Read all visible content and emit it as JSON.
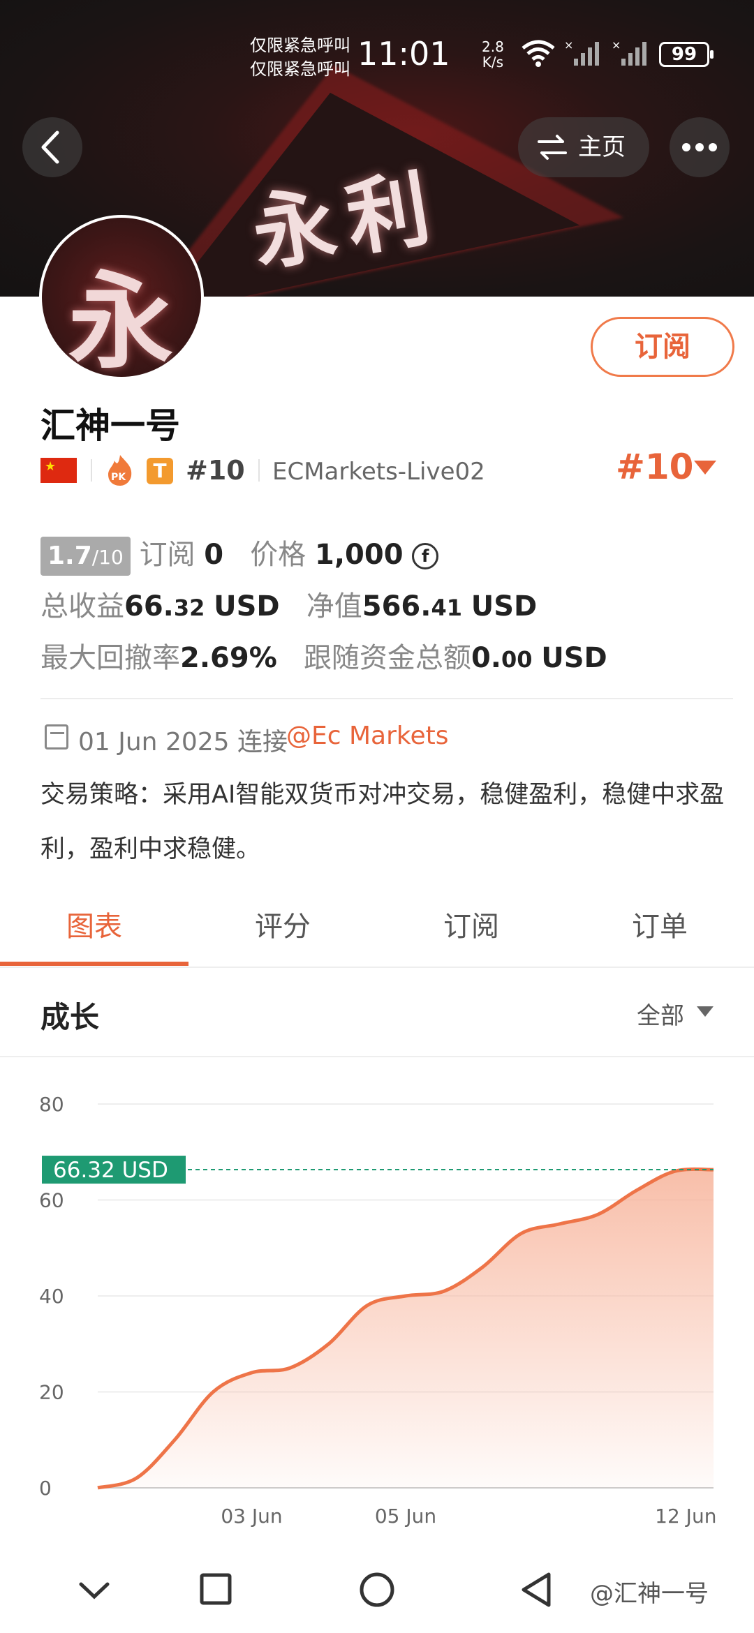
{
  "status_bar": {
    "carrier_line1": "仅限紧急呼叫",
    "carrier_line2": "仅限紧急呼叫",
    "time": "11:01",
    "speed_value": "2.8",
    "speed_unit": "K/s",
    "battery": "99"
  },
  "header": {
    "banner_text": "永利",
    "home_label": "主页"
  },
  "profile": {
    "avatar_char": "永",
    "subscribe_label": "订阅",
    "name": "汇神一号",
    "flag_icon": "china-flag-icon",
    "pk_badge": "PK",
    "t_badge": "T",
    "rank_small": "#10",
    "server": "ECMarkets-Live02",
    "rank_big": "#10"
  },
  "stats": {
    "rating_value": "1.7",
    "rating_denominator": "/10",
    "subscribe_label": "订阅",
    "subscribe_count": "0",
    "price_label": "价格",
    "price_value": "1,000",
    "total_profit_label": "总收益",
    "total_profit_int": "66.",
    "total_profit_dec": "32",
    "total_profit_unit": "USD",
    "net_value_label": "净值",
    "net_value_int": "566.",
    "net_value_dec": "41",
    "net_value_unit": "USD",
    "max_drawdown_label": "最大回撤率",
    "max_drawdown_value": "2.69%",
    "follow_funds_label": "跟随资金总额",
    "follow_funds_int": "0.",
    "follow_funds_dec": "00",
    "follow_funds_unit": "USD"
  },
  "connection": {
    "date_text": "01 Jun 2025 连接",
    "broker": "@Ec Markets"
  },
  "strategy_text": "交易策略：采用AI智能双货币对冲交易，稳健盈利，稳健中求盈利，盈利中求稳健。",
  "tabs": [
    {
      "label": "图表",
      "active": true
    },
    {
      "label": "评分",
      "active": false
    },
    {
      "label": "订阅",
      "active": false
    },
    {
      "label": "订单",
      "active": false
    }
  ],
  "section": {
    "title": "成长",
    "range": "全部"
  },
  "chart_data": {
    "type": "area",
    "title": "",
    "xlabel": "",
    "ylabel": "",
    "ylim": [
      0,
      80
    ],
    "y_ticks": [
      "0",
      "20",
      "40",
      "60",
      "80"
    ],
    "x_tick_labels": [
      "03 Jun",
      "05 Jun",
      "12 Jun"
    ],
    "current_label": "66.32 USD",
    "current_value": 66.32,
    "series": [
      {
        "values": [
          0,
          2,
          10,
          20,
          24,
          25,
          30,
          38,
          40,
          41,
          46,
          53,
          55,
          57,
          62,
          66,
          66.32
        ]
      }
    ],
    "line_color": "#ee7448",
    "fill_color": "#f7b39a",
    "label_color": "#1e9a72",
    "grid": true
  },
  "navbar": {
    "watermark": "@汇神一号"
  }
}
